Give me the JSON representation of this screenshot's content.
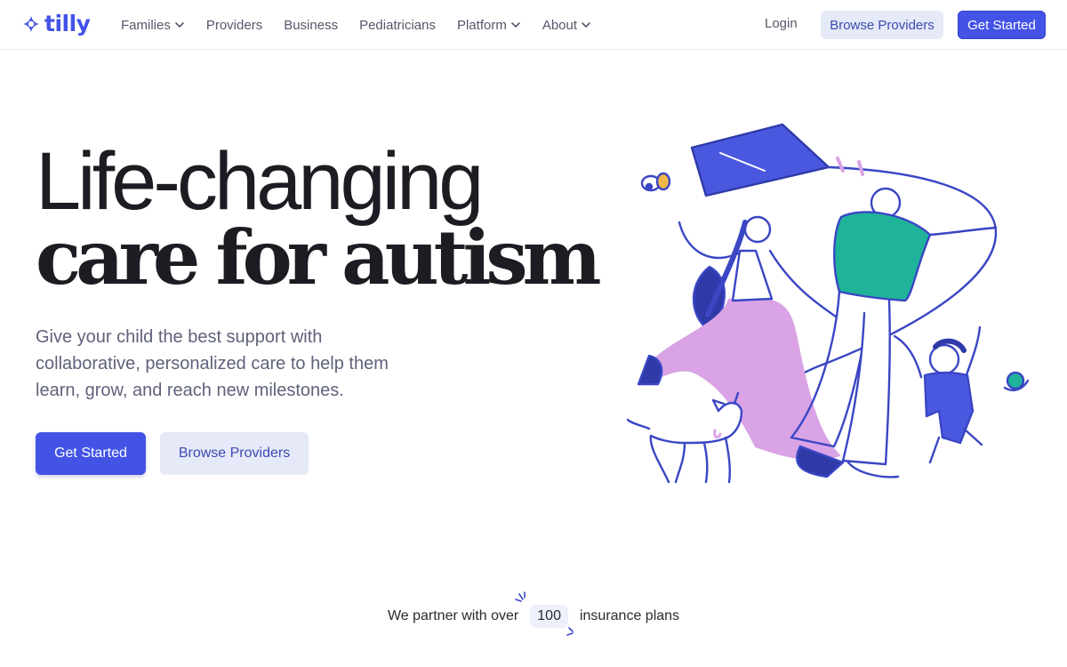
{
  "brand": {
    "name": "tilly",
    "color": "#4353e6"
  },
  "nav": {
    "items": [
      {
        "label": "Families",
        "has_dropdown": true
      },
      {
        "label": "Providers",
        "has_dropdown": false
      },
      {
        "label": "Business",
        "has_dropdown": false
      },
      {
        "label": "Pediatricians",
        "has_dropdown": false
      },
      {
        "label": "Platform",
        "has_dropdown": true
      },
      {
        "label": "About",
        "has_dropdown": true
      }
    ],
    "login": "Login",
    "browse": "Browse Providers",
    "get_started": "Get Started"
  },
  "hero": {
    "title_line1": "Life-changing",
    "title_line2": "care for autism",
    "subtitle": "Give your child the best support with collaborative, personalized care to help them learn, grow, and reach new milestones.",
    "primary_button": "Get Started",
    "secondary_button": "Browse Providers"
  },
  "partner": {
    "prefix": "We partner with over",
    "count": "100",
    "suffix": "insurance plans"
  },
  "colors": {
    "primary": "#4353e6",
    "secondary_bg": "#e6e9f7",
    "illustration_blue": "#3a46c4",
    "illustration_pink": "#d9a3e6",
    "illustration_teal": "#1fb39a"
  }
}
